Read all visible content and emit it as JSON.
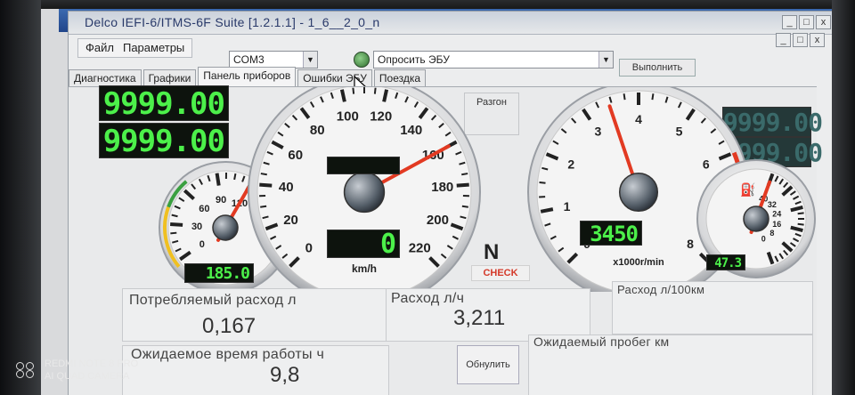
{
  "window": {
    "title": "Delco IEFI-6/ITMS-6F Suite [1.2.1.1] - 1_6__2_0_n",
    "controls": [
      "_",
      "□",
      "x"
    ]
  },
  "back_window_controls": [
    "_",
    "□",
    "x"
  ],
  "menu": {
    "file": "Файл",
    "params": "Параметры"
  },
  "port": {
    "value": "COM3"
  },
  "query": {
    "value": "Опросить ЭБУ"
  },
  "execute_label": "Выполнить",
  "tabs": [
    {
      "label": "Диагностика"
    },
    {
      "label": "Графики"
    },
    {
      "label": "Панель приборов"
    },
    {
      "label": "Ошибки ЭБУ"
    },
    {
      "label": "Поездка"
    }
  ],
  "accel_label": "Разгон",
  "lcd": {
    "left_top": "9999.00",
    "left_bottom": "9999.00",
    "right_top": "9999.00",
    "right_bottom": "9999.00",
    "coolant_temp": "185.0",
    "speed": "0",
    "rpm": "3450",
    "fuel": "47.3"
  },
  "speedometer": {
    "ticks": [
      "0",
      "20",
      "40",
      "60",
      "80",
      "100",
      "120",
      "140",
      "160",
      "180",
      "200",
      "220"
    ],
    "unit": "km/h",
    "needle_value": 160
  },
  "tachometer": {
    "ticks": [
      "0",
      "1",
      "2",
      "3",
      "4",
      "5",
      "6",
      "7",
      "8"
    ],
    "unit": "x1000r/min",
    "needle_value": 3.45
  },
  "temp_gauge": {
    "ticks": [
      "0",
      "30",
      "60",
      "90",
      "120"
    ],
    "needle_value": 145
  },
  "fuel_gauge": {
    "ticks": [
      "0",
      "8",
      "16",
      "24",
      "32",
      "40"
    ],
    "needle_value": 47.3
  },
  "gear": "N",
  "check_label": "CHECK",
  "stats": {
    "consumption_label": "Потребляемый расход л",
    "consumption_value": "0,167",
    "rate_label": "Расход л/ч",
    "rate_value": "3,211",
    "per100_label": "Расход л/100км",
    "time_label": "Ожидаемое время работы ч",
    "time_value": "9,8",
    "range_label": "Ожидаемый пробег км",
    "reset_label": "Обнулить"
  },
  "watermark": {
    "line1": "REDMI NOTE 8 PRO",
    "line2": "AI QUAD CAMERA"
  }
}
